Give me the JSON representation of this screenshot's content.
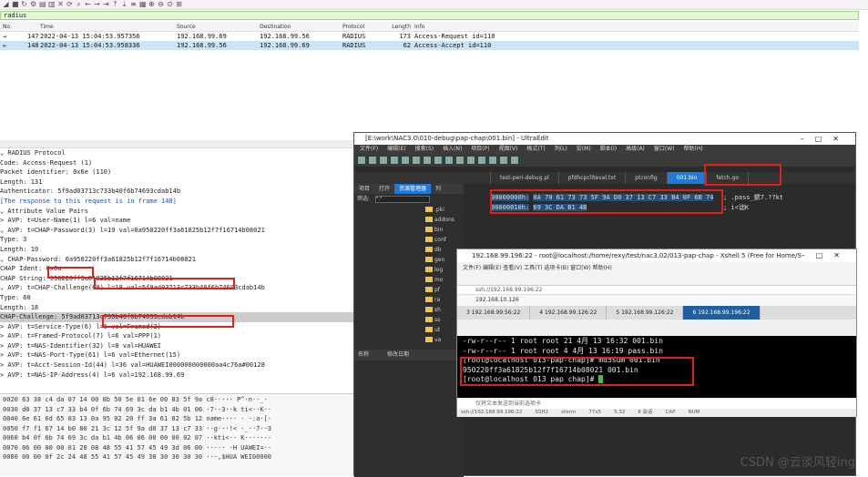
{
  "filter": {
    "value": "radius"
  },
  "packet_list": {
    "headers": [
      "No.",
      "Time",
      "Source",
      "Destination",
      "Protocol",
      "Length",
      "Info"
    ],
    "rows": [
      {
        "mark": "→",
        "no": "147",
        "time": "2022-04-13 15:04:53.957356",
        "src": "192.168.99.69",
        "dst": "192.168.99.56",
        "proto": "RADIUS",
        "len": "173",
        "info": "Access-Request id=110"
      },
      {
        "mark": "←",
        "no": "148",
        "time": "2022-04-13 15:04:53.958336",
        "src": "192.168.99.56",
        "dst": "192.168.99.69",
        "proto": "RADIUS",
        "len": "62",
        "info": "Access-Accept id=110"
      }
    ]
  },
  "details": [
    "⌄ RADIUS Protocol",
    "    Code: Access-Request (1)",
    "    Packet identifier: 0x6e (110)",
    "    Length: 131",
    "    Authenticator: 5f9ad03713c733b40f6b74693cdab14b",
    "    [The response to this request is in frame 148]",
    "  ⌄ Attribute Value Pairs",
    "    > AVP: t=User-Name(1) l=6 val=name",
    "    ⌄ AVP: t=CHAP-Password(3) l=19 val=0a950220ff3a61825b12f7f16714b08021",
    "          Type: 3",
    "          Length: 19",
    "        ⌄ CHAP-Password: 0a950220ff3a61825b12f7f16714b08021",
    "            CHAP Ident: 0x0a",
    "            CHAP String: 950220ff3a61825b12f7f16714b08021",
    "    ⌄ AVP: t=CHAP-Challenge(60) l=18 val=5f9ad03713c733b40f6b74693cdab14b",
    "          Type: 60",
    "          Length: 18",
    "          CHAP-Challenge: 5f9ad03713c733b40f6b74693cdab14b",
    "    > AVP: t=Service-Type(6) l=6 val=Framed(2)",
    "    > AVP: t=Framed-Protocol(7) l=6 val=PPP(1)",
    "    > AVP: t=NAS-Identifier(32) l=8 val=HUAWEI",
    "    > AVP: t=NAS-Port-Type(61) l=6 val=Ethernet(15)",
    "    > AVP: t=Acct-Session-Id(44) l=36 val=HUAWEI000000000000aa4c76a#00128",
    "    > AVP: t=NAS-IP-Address(4) l=6 val=192.168.99.69"
  ],
  "hex_dump": [
    "0020  63 38 c4 da 07 14 00 8b  50 5e 01 6e 00 83 5f 9a   c8·····  P^·n··_·",
    "0030  d0 37 13 c7 33 b4 0f 6b  74 69 3c da b1 4b 01 06   ·7··3··k ti<··K··",
    "0040  6e 61 6d 65 03 13 0a 95  02 20 ff 3a 61 82 5b 12   name···· · ·:a·[·",
    "0050  f7 f1 67 14 b0 80 21 3c  12 5f 9a d0 37 13 c7 33   ··g···!< ·_··7··3",
    "0060  b4 0f 6b 74 69 3c da b1  4b 06 06 00 00 00 02 07   ··kti<·· K·······",
    "0070  06 00 00 00 01 20 08 48  55 41 57 45 49 3d 06 00   ····· ·H UAWEI=··",
    "0080  00 00 0f 2c 24 48 55 41  57 45 49 30 30 30 30 30   ···,$HUA WEI00000"
  ],
  "ultraedit": {
    "title": "[E:\\work\\NAC3.0\\010-debug\\pap-chap\\001.bin] - UltraEdit",
    "menu": [
      "文件(F)",
      "编辑(E)",
      "搜索(S)",
      "插入(N)",
      "项目(P)",
      "视图(V)",
      "格式(T)",
      "列(L)",
      "宏(M)",
      "脚本(I)",
      "高级(A)",
      "窗口(W)",
      "帮助(H)"
    ],
    "tabs": [
      "test-peri-debug.pl",
      "pfdhcpcliteval.txt",
      "ptconfig",
      "001.bin",
      "fetch.go"
    ],
    "active_tab": "001.bin",
    "side_tabs": [
      "项目",
      "打开",
      "资源管理器",
      "列"
    ],
    "filter_label": "筛选:",
    "filter_value": "*.*",
    "folders": [
      ".pki",
      "addons",
      "bin",
      "conf",
      "db",
      "gen",
      "log",
      "mo",
      "pf",
      "ra",
      "sh",
      "ss",
      "ut",
      "va"
    ],
    "side_bottom": [
      "名称",
      "修改日期"
    ],
    "hex_rows": [
      {
        "addr": "00000000h:",
        "bytes": "0A 70 61 73 73 5F 9A D0 37 13 C7 33 B4 0F 6B 74",
        "ascii": "; .pass_鍶7.??kt"
      },
      {
        "addr": "00000010h:",
        "bytes": "69 3C DA B1 4B",
        "ascii": "; i<诎K"
      }
    ]
  },
  "xshell": {
    "title": "192.168.99.196:22 - root@localhost:/home/rexy/test/nac3.02/013-pap-chap - Xshell 5 (Free for Home/Sch...",
    "address": "ssh://192.168.99.196:22",
    "link": "192.168.10.126",
    "tabs": [
      "3 192.168.99.56:22",
      "4 192.168.99.126:22",
      "5 192.168.99.126:22",
      "6 192.168.99.196:22"
    ],
    "active_tab": "6 192.168.99.196:22",
    "terminal": [
      "-rw-r--r-- 1 root root 21 4月  13 16:32 001.bin",
      "-rw-r--r-- 1 root root 4 4月  13 16:19 pass.bin",
      "[root@localhost 013-pap-chap]# md5sum  001.bin",
      "950220ff3a61825b12f7f16714b08021  001.bin",
      "[root@localhost 013 pap chap]# "
    ],
    "input_placeholder": "仅将文本发送到当前选项卡",
    "status": [
      "ssh://192.168.99.196:22",
      "SSH2",
      "xterm",
      "77x5",
      "5,32",
      "6 会话",
      "CAP",
      "NUM"
    ]
  },
  "watermark": "CSDN @云淡风轻ing"
}
